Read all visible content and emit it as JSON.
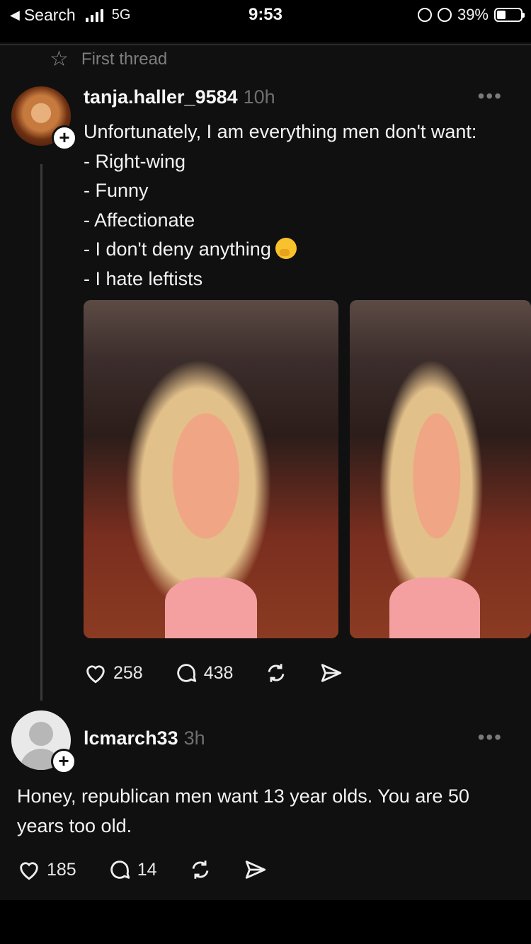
{
  "status_bar": {
    "back_label": "Search",
    "network": "5G",
    "time": "9:53",
    "battery": "39%"
  },
  "header": {
    "title": "First thread"
  },
  "post": {
    "username": "tanja.haller_9584",
    "time": "10h",
    "lines": [
      "Unfortunately, I am everything men don't want:",
      "- Right-wing",
      "- Funny",
      "- Affectionate",
      "- I don't deny anything",
      "- I hate leftists"
    ],
    "likes": "258",
    "comments": "438"
  },
  "reply": {
    "username": "lcmarch33",
    "time": "3h",
    "text": "Honey, republican men want 13 year olds. You are 50 years too old.",
    "likes": "185",
    "comments": "14"
  },
  "icons": {
    "more": "ellipsis-icon",
    "like": "heart-icon",
    "comment": "comment-icon",
    "repost": "repost-icon",
    "share": "send-icon"
  }
}
